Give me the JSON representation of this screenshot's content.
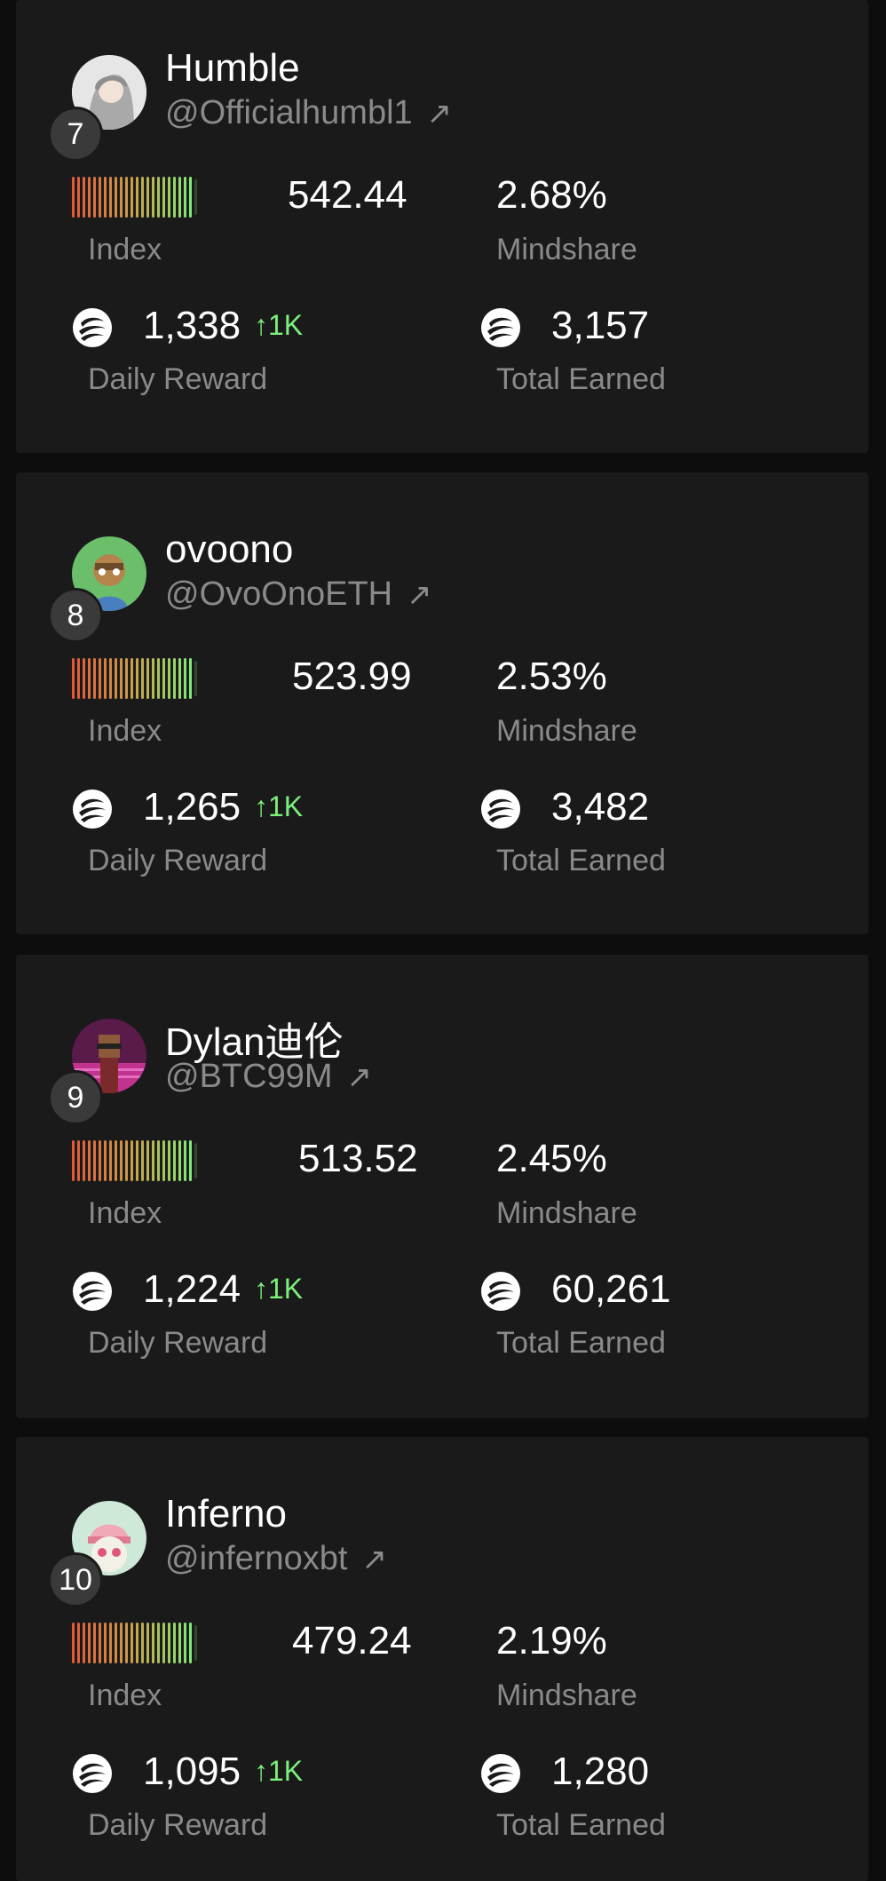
{
  "labels": {
    "index": "Index",
    "mindshare": "Mindshare",
    "daily_reward": "Daily Reward",
    "total_earned": "Total Earned"
  },
  "icons": {
    "arrow": "arrow-up-right-icon",
    "token": "token-logo-icon"
  },
  "colors": {
    "card_bg": "#1a1a1a",
    "label": "#8a8a8a",
    "positive": "#7cf07c",
    "index_gradient": [
      "#e25a3a",
      "#c9a24a",
      "#7cf07c"
    ]
  },
  "cards": [
    {
      "name": "Humble",
      "handle": "@Officialhumbl1",
      "rank": "7",
      "index": "542.44",
      "mindshare": "2.68%",
      "daily_reward": "1,338",
      "daily_delta": "↑1K",
      "total_earned": "3,157"
    },
    {
      "name": "ovoono",
      "handle": "@OvoOnoETH",
      "rank": "8",
      "index": "523.99",
      "mindshare": "2.53%",
      "daily_reward": "1,265",
      "daily_delta": "↑1K",
      "total_earned": "3,482"
    },
    {
      "name": "Dylan迪伦",
      "handle": "@BTC99M",
      "rank": "9",
      "index": "513.52",
      "mindshare": "2.45%",
      "daily_reward": "1,224",
      "daily_delta": "↑1K",
      "total_earned": "60,261"
    },
    {
      "name": "Inferno",
      "handle": "@infernoxbt",
      "rank": "10",
      "index": "479.24",
      "mindshare": "2.19%",
      "daily_reward": "1,095",
      "daily_delta": "↑1K",
      "total_earned": "1,280"
    }
  ]
}
